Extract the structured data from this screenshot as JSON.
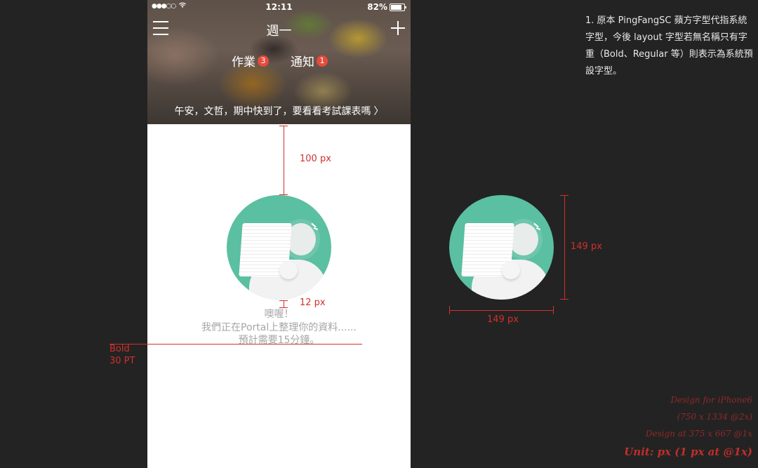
{
  "status_bar": {
    "signal": "●●●○○",
    "wifi": "wifi-icon",
    "time": "12:11",
    "battery": "82%"
  },
  "navbar": {
    "title": "週一"
  },
  "tabs": [
    {
      "label": "作業",
      "badge": "3"
    },
    {
      "label": "通知",
      "badge": "1"
    }
  ],
  "greeting": "午安，文哲，期中快到了，要看看考試課表嗎",
  "chevron": "〉",
  "empty_state": {
    "line1": "噢喔！",
    "line2": "我們正在Portal上整理你的資料......",
    "line3": "預計需要15分鐘。"
  },
  "annotations": {
    "spacing_top": "100 px",
    "spacing_bottom": "12 px",
    "font_weight": "Bold",
    "font_size": "30 PT",
    "illus_height": "149 px",
    "illus_width": "149 px"
  },
  "note": "1. 原本 PingFangSC 蘋方字型代指系統字型，今後 layout 字型若無名稱只有字重（Bold、Regular 等）則表示為系統預設字型。",
  "design_info": {
    "line1": "Design for iPhone6",
    "line2": "(750 x 1334 @2x)",
    "line3": "Design at 375 x 667 @1x",
    "unit": "Unit: px (1 px at @1x)"
  },
  "colors": {
    "illustration_bg": "#5bbfa1",
    "badge": "#e84b3c",
    "annotation": "#d0312d"
  }
}
